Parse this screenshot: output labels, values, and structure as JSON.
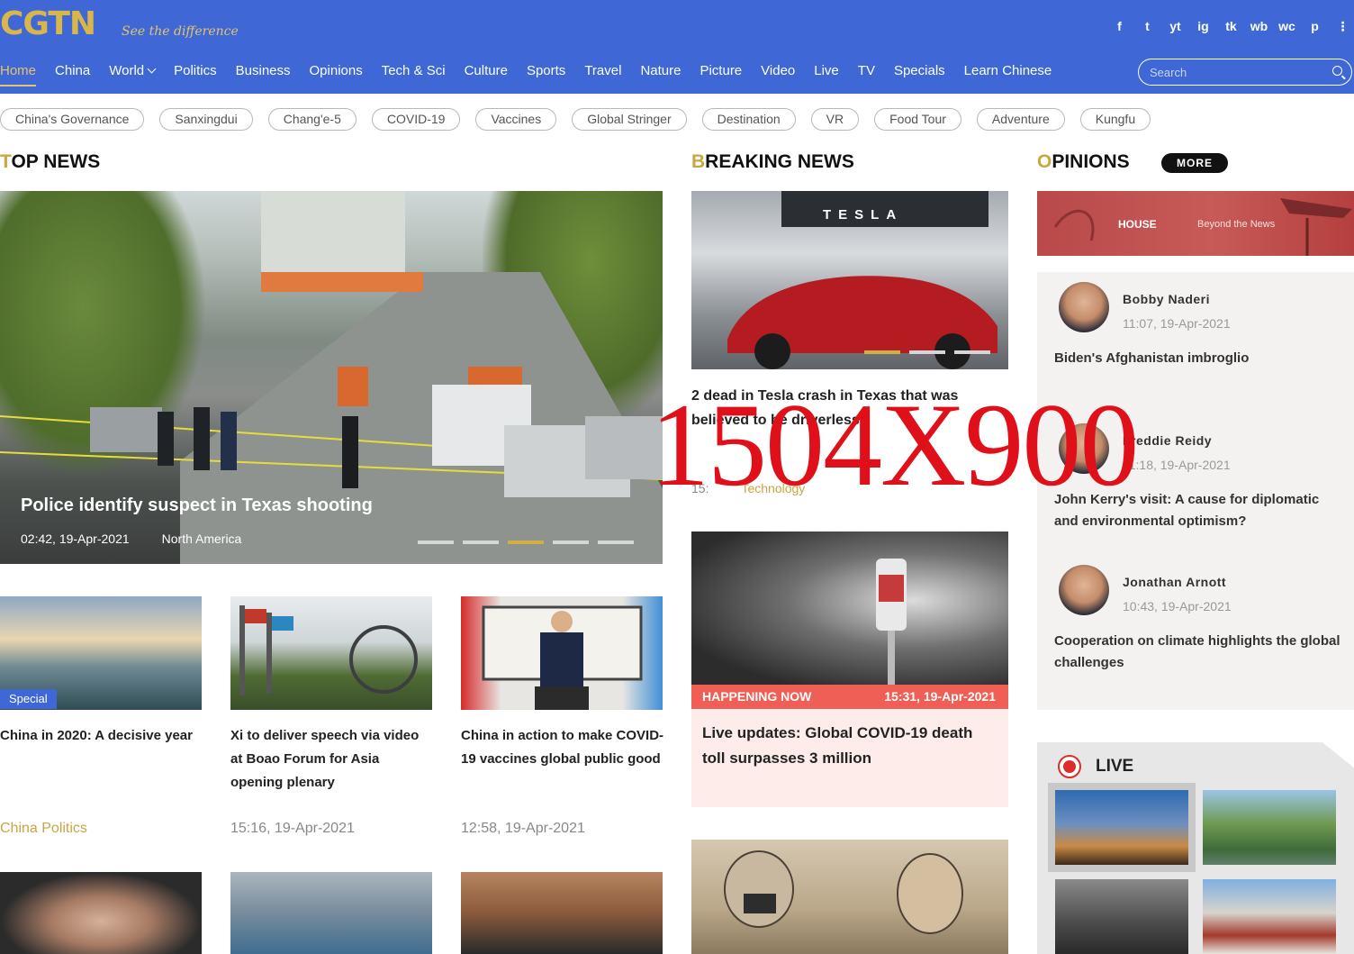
{
  "brand": {
    "logo": "CGTN",
    "tagline": "See the difference"
  },
  "social": [
    "f",
    "t",
    "yt",
    "ig",
    "tk",
    "wb",
    "wc",
    "p",
    "⋮"
  ],
  "nav": {
    "items": [
      "Home",
      "China",
      "World",
      "Politics",
      "Business",
      "Opinions",
      "Tech & Sci",
      "Culture",
      "Sports",
      "Travel",
      "Nature",
      "Picture",
      "Video",
      "Live",
      "TV",
      "Specials",
      "Learn Chinese"
    ],
    "active": "Home"
  },
  "search": {
    "placeholder": "Search"
  },
  "tags": [
    "China's Governance",
    "Sanxingdui",
    "Chang'e-5",
    "COVID-19",
    "Vaccines",
    "Global Stringer",
    "Destination",
    "VR",
    "Food Tour",
    "Adventure",
    "Kungfu"
  ],
  "sections": {
    "top_news": {
      "first": "T",
      "rest": "OP NEWS"
    },
    "breaking_news": {
      "first": "B",
      "rest": "REAKING NEWS"
    },
    "opinions": {
      "first": "O",
      "rest": "PINIONS"
    },
    "more": "MORE",
    "live": "LIVE"
  },
  "hero": {
    "title": "Police identify suspect in Texas shooting",
    "time": "02:42, 19-Apr-2021",
    "region": "North America",
    "slides": 5,
    "active_slide": 3
  },
  "cards": [
    {
      "title": "China in 2020: A decisive year",
      "meta": "China Politics",
      "badge": "Special"
    },
    {
      "title": "Xi to deliver speech via video at Boao Forum for Asia opening plenary",
      "meta": "15:16, 19-Apr-2021"
    },
    {
      "title": "China in action to make COVID-19 vaccines global public good",
      "meta": "12:58, 19-Apr-2021"
    }
  ],
  "breaking": {
    "title": "2 dead in Tesla crash in Texas that was believed to be driverless",
    "time": "15:",
    "category": "Technology",
    "slides": 3,
    "active_slide": 1,
    "tesla_sign": "TESLA"
  },
  "happening": {
    "label": "HAPPENING NOW",
    "time": "15:31, 19-Apr-2021",
    "title": "Live updates: Global COVID-19 death toll surpasses 3 million"
  },
  "opinion_banner": {
    "brand": "HOUSE",
    "slogan": "Beyond the News"
  },
  "opinions": [
    {
      "name": "Bobby Naderi",
      "time": "11:07, 19-Apr-2021",
      "title": "Biden's Afghanistan imbroglio"
    },
    {
      "name": "Freddie Reidy",
      "time": "11:18, 19-Apr-2021",
      "title": "John Kerry's visit: A cause for diplomatic and environmental optimism?"
    },
    {
      "name": "Jonathan Arnott",
      "time": "10:43, 19-Apr-2021",
      "title": "Cooperation on climate highlights the global challenges"
    }
  ],
  "watermark": "1504X900",
  "colors": {
    "header": "#3f68d6",
    "gold": "#c8a640",
    "happening": "#f05f55",
    "watermark": "#e0101b"
  }
}
